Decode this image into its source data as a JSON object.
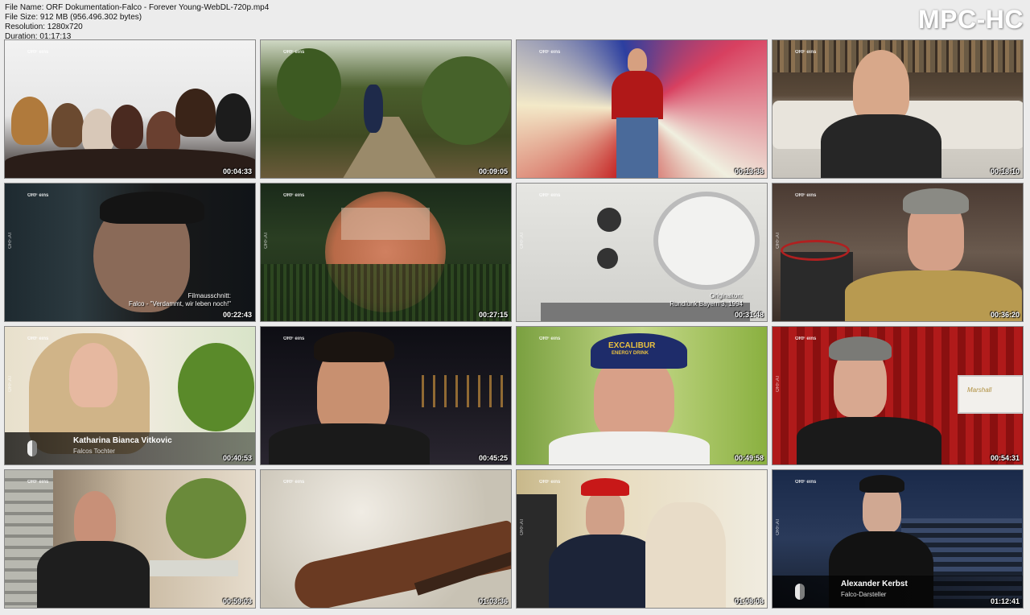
{
  "file_info": {
    "name_line": "File Name: ORF Dokumentation-Falco - Forever Young-WebDL-720p.mp4",
    "size_line": "File Size: 912 MB (956.496.302 bytes)",
    "resolution_line": "Resolution: 1280x720",
    "duration_line": "Duration: 01:17:13"
  },
  "brand": "MPC-HC",
  "channel_logo": "ORF eins",
  "side_logo": "ORF.AT",
  "thumbnails": [
    {
      "timestamp": "00:04:33"
    },
    {
      "timestamp": "00:09:05"
    },
    {
      "timestamp": "00:13:38"
    },
    {
      "timestamp": "00:18:10"
    },
    {
      "timestamp": "00:22:43",
      "caption_1": "Filmausschnitt:",
      "caption_2": "Falco - \"Verdammt, wir leben noch!\""
    },
    {
      "timestamp": "00:27:15"
    },
    {
      "timestamp": "00:31:48",
      "caption_1": "Originalton:",
      "caption_2": "Rundfunk Bayern 3, 1994"
    },
    {
      "timestamp": "00:36:20"
    },
    {
      "timestamp": "00:40:53",
      "name": "Katharina Bianca Vitkovic",
      "role": "Falcos Tochter"
    },
    {
      "timestamp": "00:45:25"
    },
    {
      "timestamp": "00:49:58",
      "cap_text_1": "EXCALIBUR",
      "cap_text_2": "ENERGY DRINK"
    },
    {
      "timestamp": "00:54:31",
      "amp_text": "Marshall"
    },
    {
      "timestamp": "00:59:03"
    },
    {
      "timestamp": "01:03:36"
    },
    {
      "timestamp": "01:08:08"
    },
    {
      "timestamp": "01:12:41",
      "name": "Alexander Kerbst",
      "role": "Falco-Darsteller"
    }
  ]
}
